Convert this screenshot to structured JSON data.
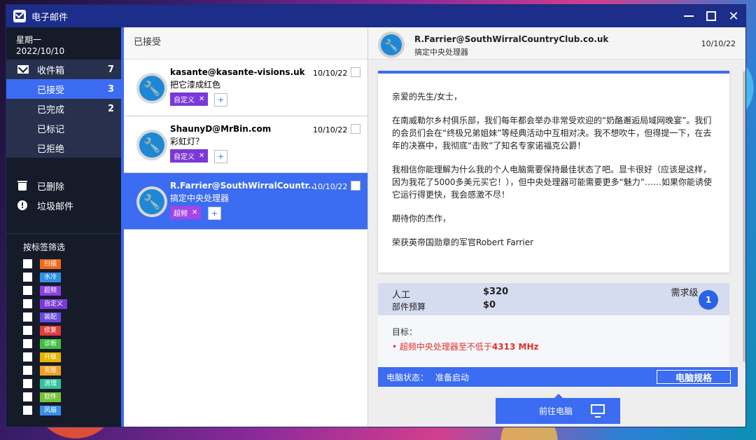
{
  "window": {
    "title": "电子邮件"
  },
  "sidebar": {
    "day": "星期一",
    "date": "2022/10/10",
    "inbox": {
      "label": "收件箱",
      "count": "7"
    },
    "subitems": [
      {
        "label": "已接受",
        "count": "3"
      },
      {
        "label": "已完成",
        "count": "2"
      },
      {
        "label": "已标记",
        "count": ""
      },
      {
        "label": "已拒绝",
        "count": ""
      }
    ],
    "deleted": "已删除",
    "spam": "垃圾邮件",
    "filter_title": "按标签筛选",
    "tags": [
      {
        "label": "扫描",
        "color": "#f26a1b"
      },
      {
        "label": "水冷",
        "color": "#2e8fe6"
      },
      {
        "label": "超频",
        "color": "#8b3fe0"
      },
      {
        "label": "自定义",
        "color": "#7b38d8"
      },
      {
        "label": "装配",
        "color": "#6a4be0"
      },
      {
        "label": "修复",
        "color": "#e23c3c"
      },
      {
        "label": "诊断",
        "color": "#3fbf3f"
      },
      {
        "label": "升级",
        "color": "#e8b300"
      },
      {
        "label": "克隆",
        "color": "#f0a020"
      },
      {
        "label": "清理",
        "color": "#2ec39a"
      },
      {
        "label": "软件",
        "color": "#74c43a"
      },
      {
        "label": "风扇",
        "color": "#3a8fe8"
      }
    ]
  },
  "list": {
    "header": "已接受",
    "messages": [
      {
        "from": "kasante@kasante-visions.uk",
        "subject": "把它漆成红色",
        "date": "10/10/22",
        "tag": "自定义",
        "tag_color": "#7b38d8"
      },
      {
        "from": "ShaunyD@MrBin.com",
        "subject": "彩虹灯？",
        "date": "10/10/22",
        "tag": "自定义",
        "tag_color": "#7b38d8"
      },
      {
        "from": "R.Farrier@SouthWirralCountr...",
        "subject": "搞定中央处理器",
        "date": "10/10/22",
        "tag": "超频",
        "tag_color": "#a445e8"
      }
    ]
  },
  "detail": {
    "from": "R.Farrier@SouthWirralCountryClub.co.uk",
    "subject": "搞定中央处理器",
    "date": "10/10/22",
    "body": {
      "greeting": "亲爱的先生/女士，",
      "p1": "在南威勒尔乡村俱乐部，我们每年都会举办非常受欢迎的“奶酪邂逅局域网晚宴”。我们的会员们会在“终极兄弟姐妹”等经典活动中互相对决。我不想吹牛，但得提一下，在去年的决赛中，我彻底“击败”了知名专家诺福克公爵！",
      "p2": "我相信你能理解为什么我的个人电脑需要保持最佳状态了吧。显卡很好（应该是这样，因为我花了5000多美元买它！），但中央处理器可能需要更多“魅力”……如果你能诱使它运行得更快，我会感激不尽！",
      "p3": "期待你的杰作，",
      "sign": "荣获英帝国勋章的军官Robert Farrier"
    },
    "labor_label": "人工",
    "labor_value": "$320",
    "parts_label": "部件预算",
    "parts_value": "$0",
    "req_label": "需求级",
    "req_level": "1",
    "goal_title": "目标：",
    "goal_prefix": "超频中央处理器至不低于",
    "goal_value": "4313 MHz",
    "status_label": "电脑状态：",
    "status_value": "准备启动",
    "spec_button": "电脑规格",
    "goto_button": "前往电脑"
  }
}
